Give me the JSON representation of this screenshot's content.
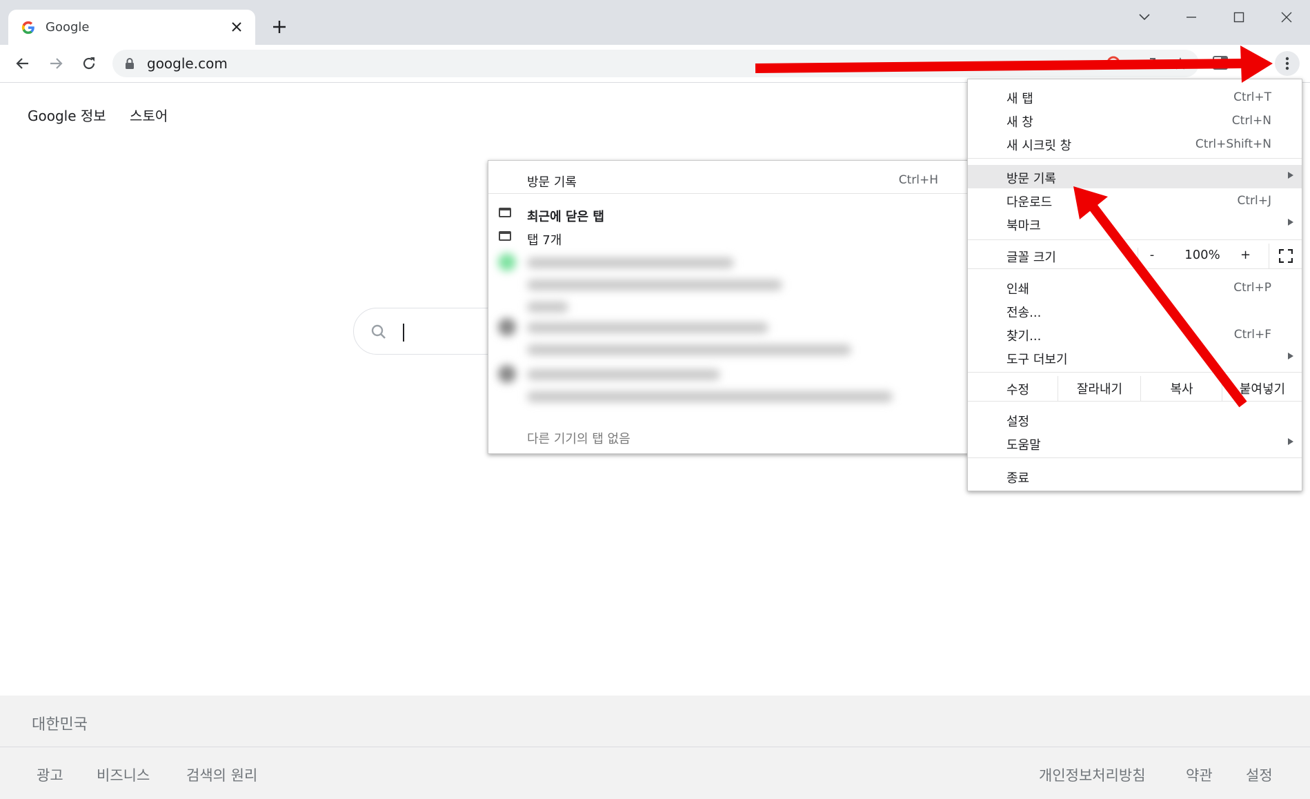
{
  "tab": {
    "title": "Google"
  },
  "toolbar": {
    "url": "google.com"
  },
  "page": {
    "top_links": [
      "Google 정보",
      "스토어"
    ],
    "footer_country": "대한민국",
    "footer_left": [
      "광고",
      "비즈니스",
      "검색의 원리"
    ],
    "footer_right": [
      "개인정보처리방침",
      "약관",
      "설정"
    ]
  },
  "main_menu": {
    "new_tab": {
      "label": "새 탭",
      "shortcut": "Ctrl+T"
    },
    "new_window": {
      "label": "새 창",
      "shortcut": "Ctrl+N"
    },
    "incognito": {
      "label": "새 시크릿 창",
      "shortcut": "Ctrl+Shift+N"
    },
    "history": {
      "label": "방문 기록"
    },
    "downloads": {
      "label": "다운로드",
      "shortcut": "Ctrl+J"
    },
    "bookmarks": {
      "label": "북마크"
    },
    "zoom": {
      "label": "글꼴 크기",
      "minus": "-",
      "value": "100%",
      "plus": "+"
    },
    "print": {
      "label": "인쇄",
      "shortcut": "Ctrl+P"
    },
    "cast": {
      "label": "전송..."
    },
    "find": {
      "label": "찾기...",
      "shortcut": "Ctrl+F"
    },
    "more_tools": {
      "label": "도구 더보기"
    },
    "edit": {
      "label": "수정",
      "cut": "잘라내기",
      "copy": "복사",
      "paste": "붙여넣기"
    },
    "settings": {
      "label": "설정"
    },
    "help": {
      "label": "도움말"
    },
    "exit": {
      "label": "종료"
    }
  },
  "history_menu": {
    "history": {
      "label": "방문 기록",
      "shortcut": "Ctrl+H"
    },
    "recently_closed": {
      "label": "최근에 닫은 탭"
    },
    "tabs_group": {
      "label": "탭 7개"
    },
    "no_other_devices": {
      "label": "다른 기기의 탭 없음"
    }
  },
  "colors": {
    "annotation_arrow": "#ee0000",
    "tabstrip": "#dee1e6",
    "menu_highlight": "#e8e8e9"
  }
}
